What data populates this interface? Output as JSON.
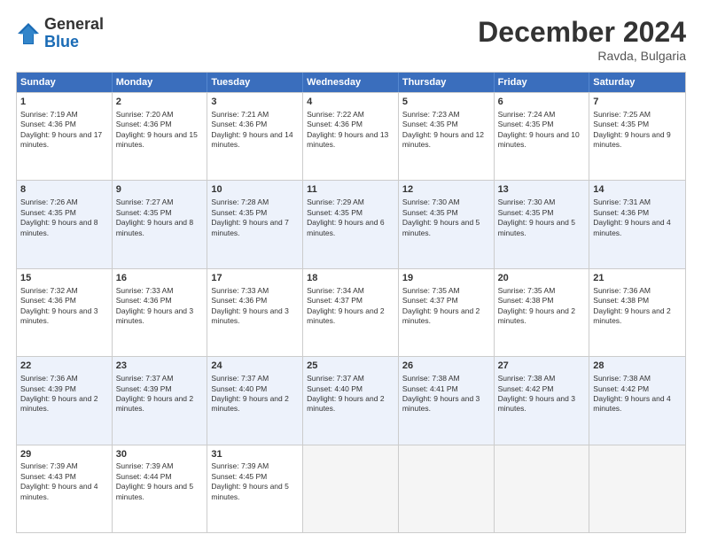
{
  "logo": {
    "general": "General",
    "blue": "Blue"
  },
  "title": "December 2024",
  "subtitle": "Ravda, Bulgaria",
  "headers": [
    "Sunday",
    "Monday",
    "Tuesday",
    "Wednesday",
    "Thursday",
    "Friday",
    "Saturday"
  ],
  "rows": [
    [
      {
        "day": "1",
        "sunrise": "7:19 AM",
        "sunset": "4:36 PM",
        "daylight": "9 hours and 17 minutes."
      },
      {
        "day": "2",
        "sunrise": "7:20 AM",
        "sunset": "4:36 PM",
        "daylight": "9 hours and 15 minutes."
      },
      {
        "day": "3",
        "sunrise": "7:21 AM",
        "sunset": "4:36 PM",
        "daylight": "9 hours and 14 minutes."
      },
      {
        "day": "4",
        "sunrise": "7:22 AM",
        "sunset": "4:36 PM",
        "daylight": "9 hours and 13 minutes."
      },
      {
        "day": "5",
        "sunrise": "7:23 AM",
        "sunset": "4:35 PM",
        "daylight": "9 hours and 12 minutes."
      },
      {
        "day": "6",
        "sunrise": "7:24 AM",
        "sunset": "4:35 PM",
        "daylight": "9 hours and 10 minutes."
      },
      {
        "day": "7",
        "sunrise": "7:25 AM",
        "sunset": "4:35 PM",
        "daylight": "9 hours and 9 minutes."
      }
    ],
    [
      {
        "day": "8",
        "sunrise": "7:26 AM",
        "sunset": "4:35 PM",
        "daylight": "9 hours and 8 minutes."
      },
      {
        "day": "9",
        "sunrise": "7:27 AM",
        "sunset": "4:35 PM",
        "daylight": "9 hours and 8 minutes."
      },
      {
        "day": "10",
        "sunrise": "7:28 AM",
        "sunset": "4:35 PM",
        "daylight": "9 hours and 7 minutes."
      },
      {
        "day": "11",
        "sunrise": "7:29 AM",
        "sunset": "4:35 PM",
        "daylight": "9 hours and 6 minutes."
      },
      {
        "day": "12",
        "sunrise": "7:30 AM",
        "sunset": "4:35 PM",
        "daylight": "9 hours and 5 minutes."
      },
      {
        "day": "13",
        "sunrise": "7:30 AM",
        "sunset": "4:35 PM",
        "daylight": "9 hours and 5 minutes."
      },
      {
        "day": "14",
        "sunrise": "7:31 AM",
        "sunset": "4:36 PM",
        "daylight": "9 hours and 4 minutes."
      }
    ],
    [
      {
        "day": "15",
        "sunrise": "7:32 AM",
        "sunset": "4:36 PM",
        "daylight": "9 hours and 3 minutes."
      },
      {
        "day": "16",
        "sunrise": "7:33 AM",
        "sunset": "4:36 PM",
        "daylight": "9 hours and 3 minutes."
      },
      {
        "day": "17",
        "sunrise": "7:33 AM",
        "sunset": "4:36 PM",
        "daylight": "9 hours and 3 minutes."
      },
      {
        "day": "18",
        "sunrise": "7:34 AM",
        "sunset": "4:37 PM",
        "daylight": "9 hours and 2 minutes."
      },
      {
        "day": "19",
        "sunrise": "7:35 AM",
        "sunset": "4:37 PM",
        "daylight": "9 hours and 2 minutes."
      },
      {
        "day": "20",
        "sunrise": "7:35 AM",
        "sunset": "4:38 PM",
        "daylight": "9 hours and 2 minutes."
      },
      {
        "day": "21",
        "sunrise": "7:36 AM",
        "sunset": "4:38 PM",
        "daylight": "9 hours and 2 minutes."
      }
    ],
    [
      {
        "day": "22",
        "sunrise": "7:36 AM",
        "sunset": "4:39 PM",
        "daylight": "9 hours and 2 minutes."
      },
      {
        "day": "23",
        "sunrise": "7:37 AM",
        "sunset": "4:39 PM",
        "daylight": "9 hours and 2 minutes."
      },
      {
        "day": "24",
        "sunrise": "7:37 AM",
        "sunset": "4:40 PM",
        "daylight": "9 hours and 2 minutes."
      },
      {
        "day": "25",
        "sunrise": "7:37 AM",
        "sunset": "4:40 PM",
        "daylight": "9 hours and 2 minutes."
      },
      {
        "day": "26",
        "sunrise": "7:38 AM",
        "sunset": "4:41 PM",
        "daylight": "9 hours and 3 minutes."
      },
      {
        "day": "27",
        "sunrise": "7:38 AM",
        "sunset": "4:42 PM",
        "daylight": "9 hours and 3 minutes."
      },
      {
        "day": "28",
        "sunrise": "7:38 AM",
        "sunset": "4:42 PM",
        "daylight": "9 hours and 4 minutes."
      }
    ],
    [
      {
        "day": "29",
        "sunrise": "7:39 AM",
        "sunset": "4:43 PM",
        "daylight": "9 hours and 4 minutes."
      },
      {
        "day": "30",
        "sunrise": "7:39 AM",
        "sunset": "4:44 PM",
        "daylight": "9 hours and 5 minutes."
      },
      {
        "day": "31",
        "sunrise": "7:39 AM",
        "sunset": "4:45 PM",
        "daylight": "9 hours and 5 minutes."
      },
      null,
      null,
      null,
      null
    ]
  ],
  "labels": {
    "sunrise": "Sunrise:",
    "sunset": "Sunset:",
    "daylight": "Daylight:"
  }
}
